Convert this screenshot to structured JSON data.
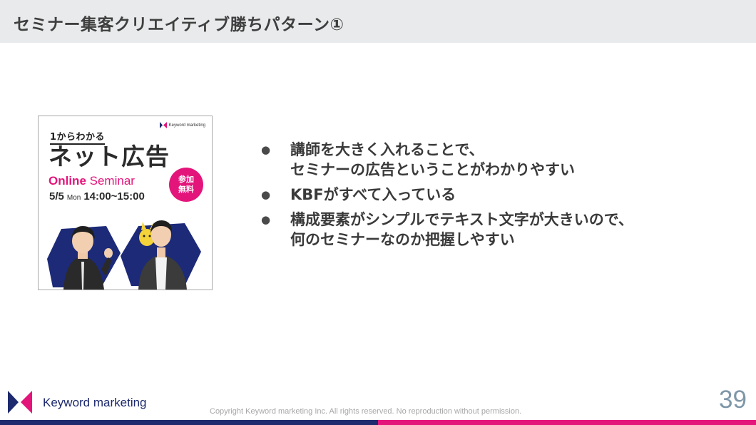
{
  "title": "セミナー集客クリエイティブ勝ちパターン①",
  "banner": {
    "logo_text": "Keyword marketing",
    "subtitle": "1からわかる",
    "main_title": "ネット広告",
    "online_bold": "Online",
    "online_rest": " Seminar",
    "date": "5/5",
    "day": "Mon",
    "time": "14:00~15:00",
    "badge_line1": "参加",
    "badge_line2": "無料"
  },
  "bullets": [
    {
      "lines": [
        "講師を大きく入れることで、",
        "セミナーの広告ということがわかりやすい"
      ]
    },
    {
      "lines": [
        "KBFがすべて入っている"
      ]
    },
    {
      "lines": [
        "構成要素がシンプルでテキスト文字が大きいので、",
        "何のセミナーなのか把握しやすい"
      ]
    }
  ],
  "footer": {
    "brand": "Keyword marketing",
    "copyright": "Copyright Keyword marketing Inc. All rights reserved. No reproduction without permission.",
    "page_number": "39"
  },
  "colors": {
    "brand_navy": "#1d2a6e",
    "brand_pink": "#e3157b",
    "title_bar": "#e8eaeb",
    "page_number": "#7f97a8"
  }
}
